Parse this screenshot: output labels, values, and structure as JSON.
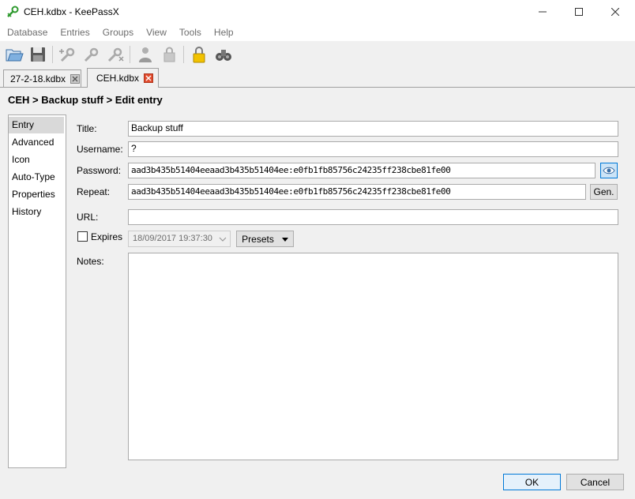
{
  "window": {
    "title": "CEH.kdbx - KeePassX"
  },
  "menu": [
    "Database",
    "Entries",
    "Groups",
    "View",
    "Tools",
    "Help"
  ],
  "tabs": [
    {
      "label": "27-2-18.kdbx",
      "active": false
    },
    {
      "label": "CEH.kdbx",
      "active": true
    }
  ],
  "breadcrumb": "CEH > Backup stuff > Edit entry",
  "categories": [
    "Entry",
    "Advanced",
    "Icon",
    "Auto-Type",
    "Properties",
    "History"
  ],
  "form": {
    "title_label": "Title:",
    "title_value": "Backup stuff",
    "username_label": "Username:",
    "username_value": "?",
    "password_label": "Password:",
    "password_value": "aad3b435b51404eeaad3b435b51404ee:e0fb1fb85756c24235ff238cbe81fe00",
    "repeat_label": "Repeat:",
    "repeat_value": "aad3b435b51404eeaad3b435b51404ee:e0fb1fb85756c24235ff238cbe81fe00",
    "gen_label": "Gen.",
    "url_label": "URL:",
    "url_value": "",
    "expires_label": "Expires",
    "expires_value": "18/09/2017 19:37:30",
    "presets_label": "Presets",
    "notes_label": "Notes:",
    "notes_value": ""
  },
  "buttons": {
    "ok": "OK",
    "cancel": "Cancel"
  },
  "colors": {
    "accent": "#0078d7",
    "close_tab_active": "#e04c2f"
  }
}
